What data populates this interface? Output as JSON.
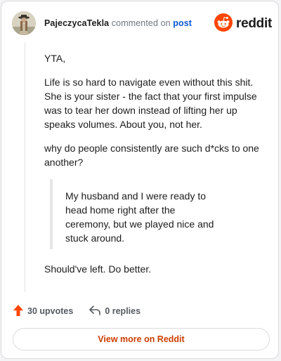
{
  "header": {
    "username": "PajeczycaTekla",
    "action_text": "commented on",
    "post_link": "post",
    "brand": "reddit"
  },
  "comment": {
    "paragraphs": [
      "YTA,",
      "Life is so hard to navigate even without this shit. She is your sister - the fact that your first impulse was to tear her down instead of lifting her up speaks volumes. About you, not her.",
      "why do people consistently are such d*cks to one another?"
    ],
    "quote": "My husband and I were ready to head home right after the ceremony, but we played nice and stuck around.",
    "closing": "Should've left. Do better."
  },
  "actions": {
    "upvotes": "30 upvotes",
    "replies": "0 replies"
  },
  "footer": {
    "view_button": "View more on Reddit"
  },
  "colors": {
    "brand_orange": "#ff4500",
    "link_blue": "#0b57d0",
    "button_text": "#cc3d00"
  },
  "icons": {
    "upvote": "upvote-arrow-icon",
    "reply": "reply-arrow-icon",
    "brand": "reddit-logo-icon"
  }
}
